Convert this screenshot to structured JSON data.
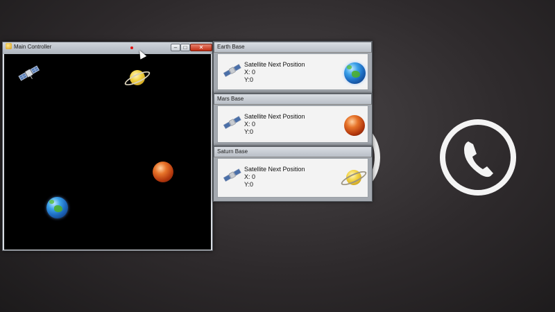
{
  "main_window": {
    "title": "Main Controller",
    "controls": {
      "minimize": "–",
      "maximize": "□",
      "close": "✕"
    }
  },
  "bases": [
    {
      "title": "Earth Base",
      "heading": "Satellite Next Position",
      "x_label": "X: 0",
      "y_label": "Y:0",
      "planet": "earth-icon"
    },
    {
      "title": "Mars Base",
      "heading": "Satellite Next Position",
      "x_label": "X: 0",
      "y_label": "Y:0",
      "planet": "mars-icon"
    },
    {
      "title": "Saturn Base",
      "heading": "Satellite Next Position",
      "x_label": "X: 0",
      "y_label": "Y:0",
      "planet": "saturn-icon"
    }
  ],
  "background": {
    "icons": [
      "phone-icon"
    ]
  },
  "colors": {
    "space": "#000000",
    "close_button": "#c22e14",
    "ring": "#f4f4f4"
  }
}
